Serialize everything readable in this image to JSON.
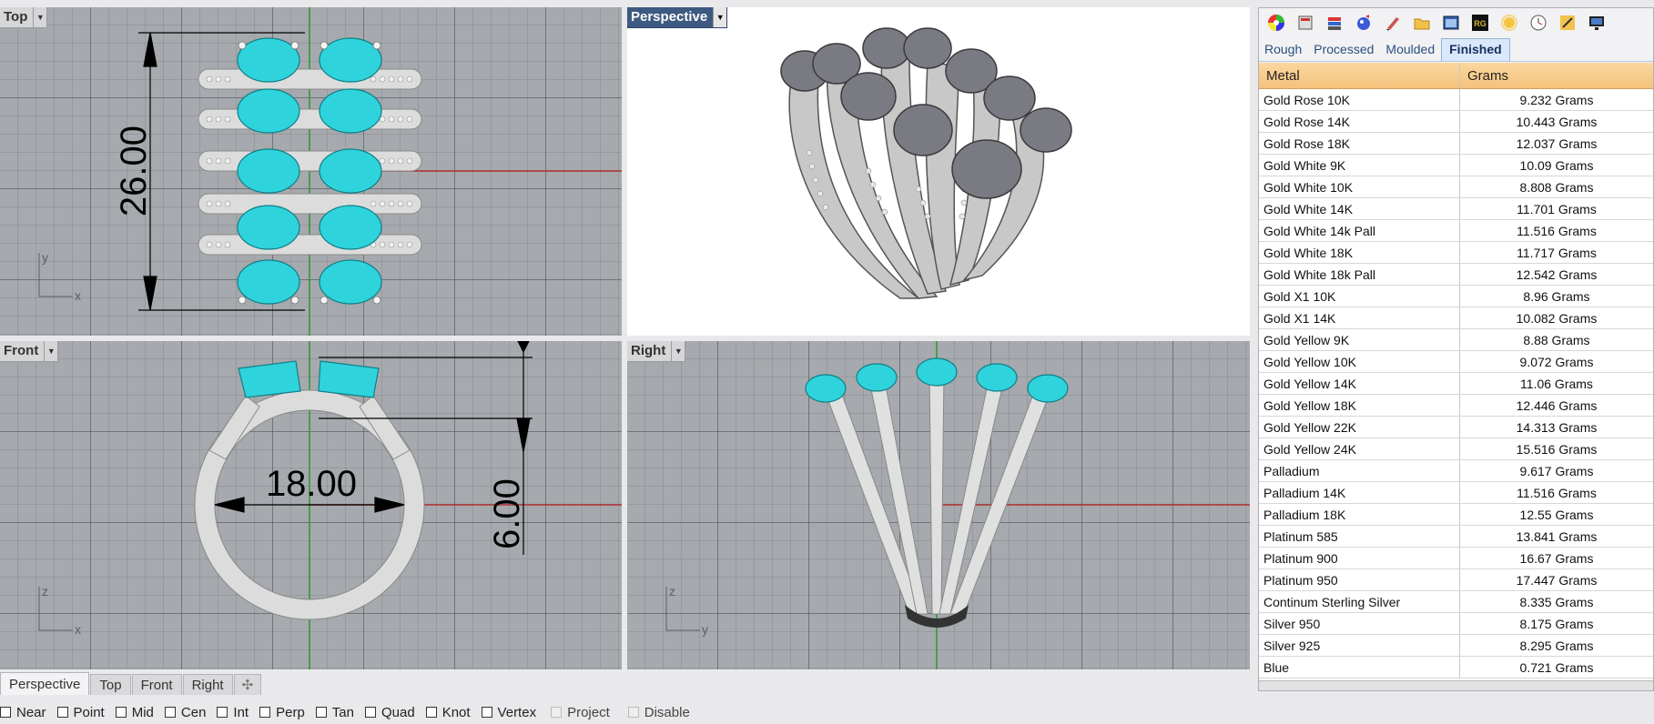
{
  "viewports": {
    "top": {
      "label": "Top",
      "axis_a": "y",
      "axis_b": "x",
      "dim": "26.00"
    },
    "perspective": {
      "label": "Perspective"
    },
    "front": {
      "label": "Front",
      "axis_a": "z",
      "axis_b": "x",
      "dim_width": "18.00",
      "dim_height": "6.00"
    },
    "right": {
      "label": "Right",
      "axis_a": "z",
      "axis_b": "y"
    }
  },
  "tabs": [
    "Perspective",
    "Top",
    "Front",
    "Right"
  ],
  "osnaps": [
    {
      "label": "Near",
      "enabled": true
    },
    {
      "label": "Point",
      "enabled": true
    },
    {
      "label": "Mid",
      "enabled": true
    },
    {
      "label": "Cen",
      "enabled": true
    },
    {
      "label": "Int",
      "enabled": true
    },
    {
      "label": "Perp",
      "enabled": true
    },
    {
      "label": "Tan",
      "enabled": true
    },
    {
      "label": "Quad",
      "enabled": true
    },
    {
      "label": "Knot",
      "enabled": true
    },
    {
      "label": "Vertex",
      "enabled": true
    },
    {
      "label": "Project",
      "enabled": false
    },
    {
      "label": "Disable",
      "enabled": false
    }
  ],
  "panel": {
    "icons": [
      "color-wheel-icon",
      "display-icon",
      "layers-icon",
      "material-ball-icon",
      "brush-icon",
      "folder-icon",
      "render-window-icon",
      "rg-plugin-icon",
      "sun-icon",
      "clock-icon",
      "tools-icon",
      "monitor-icon"
    ],
    "tabs": [
      "Rough",
      "Processed",
      "Moulded",
      "Finished"
    ],
    "active_tab": "Finished",
    "columns": [
      "Metal",
      "Grams"
    ],
    "rows": [
      [
        "Gold Rose 10K",
        "9.232 Grams"
      ],
      [
        "Gold Rose 14K",
        "10.443 Grams"
      ],
      [
        "Gold Rose 18K",
        "12.037 Grams"
      ],
      [
        "Gold White 9K",
        "10.09 Grams"
      ],
      [
        "Gold White 10K",
        "8.808 Grams"
      ],
      [
        "Gold White 14K",
        "11.701 Grams"
      ],
      [
        "Gold White 14k Pall",
        "11.516 Grams"
      ],
      [
        "Gold White 18K",
        "11.717 Grams"
      ],
      [
        "Gold White 18k Pall",
        "12.542 Grams"
      ],
      [
        "Gold X1 10K",
        "8.96 Grams"
      ],
      [
        "Gold X1 14K",
        "10.082 Grams"
      ],
      [
        "Gold Yellow 9K",
        "8.88 Grams"
      ],
      [
        "Gold Yellow 10K",
        "9.072 Grams"
      ],
      [
        "Gold Yellow 14K",
        "11.06 Grams"
      ],
      [
        "Gold Yellow 18K",
        "12.446 Grams"
      ],
      [
        "Gold Yellow 22K",
        "14.313 Grams"
      ],
      [
        "Gold Yellow 24K",
        "15.516 Grams"
      ],
      [
        "Palladium",
        "9.617 Grams"
      ],
      [
        "Palladium 14K",
        "11.516 Grams"
      ],
      [
        "Palladium 18K",
        "12.55 Grams"
      ],
      [
        "Platinum 585",
        "13.841 Grams"
      ],
      [
        "Platinum 900",
        "16.67 Grams"
      ],
      [
        "Platinum 950",
        "17.447 Grams"
      ],
      [
        "Continum Sterling Silver",
        "8.335 Grams"
      ],
      [
        "Silver 950",
        "8.175 Grams"
      ],
      [
        "Silver 925",
        "8.295 Grams"
      ],
      [
        "Blue",
        "0.721 Grams"
      ]
    ]
  },
  "colors": {
    "gem": "#2fd3dc",
    "metal": "#d9d9d9",
    "viewport_bg": "#a6a9ad",
    "active_label": "#3e5a80",
    "header_orange": "#f5c27b",
    "x_axis": "#b03030",
    "y_axis": "#2e9a2e"
  }
}
